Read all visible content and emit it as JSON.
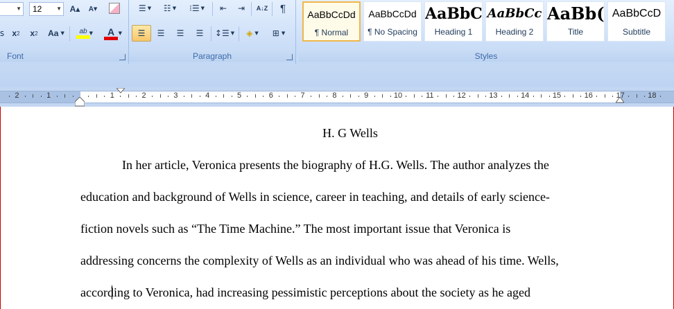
{
  "font_group": {
    "label": "Font",
    "size_value": "12",
    "grow_label": "A",
    "shrink_label": "A",
    "change_case_label": "Aa",
    "highlight_label": "ab",
    "font_color_label": "A",
    "subscript_label": "x",
    "superscript_label": "x",
    "subscript_mark": "2",
    "superscript_mark": "2",
    "highlight_color": "#ffff00",
    "font_color": "#e00000"
  },
  "paragraph_group": {
    "label": "Paragraph",
    "pilcrow": "¶",
    "sort_label": "A↓Z"
  },
  "styles_group": {
    "label": "Styles",
    "items": [
      {
        "preview": "AaBbCcDd",
        "name": "¶ Normal"
      },
      {
        "preview": "AaBbCcDd",
        "name": "¶ No Spacing"
      },
      {
        "preview": "AaBbC",
        "name": "Heading 1"
      },
      {
        "preview": "AaBbCc",
        "name": "Heading 2"
      },
      {
        "preview": "AaBb(",
        "name": "Title"
      },
      {
        "preview": "AaBbCcD",
        "name": "Subtitle"
      }
    ]
  },
  "ruler": {
    "labels": [
      "2",
      "1",
      "1",
      "2",
      "3",
      "4",
      "5",
      "6",
      "7",
      "8",
      "9",
      "10",
      "11",
      "12",
      "13",
      "14",
      "15",
      "16",
      "17",
      "18"
    ]
  },
  "document": {
    "title": "H. G Wells",
    "lines": [
      "In her article, Veronica presents the biography of H.G.  Wells. The author analyzes the",
      "education and background of Wells in science, career in teaching, and details of early science-",
      "fiction novels such as “The Time Machine.” The most important issue that Veronica is",
      "addressing concerns the complexity of Wells as an individual who was ahead of his time. Wells,",
      "according to Veronica, had increasing pessimistic perceptions about the society as he aged"
    ]
  }
}
